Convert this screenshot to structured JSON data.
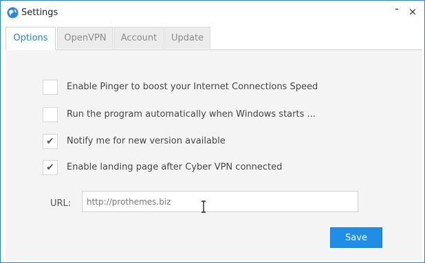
{
  "window": {
    "title": "Settings"
  },
  "controls": {
    "minimize": "-",
    "close": "×"
  },
  "tabs": [
    {
      "label": "Options",
      "active": true
    },
    {
      "label": "OpenVPN",
      "active": false
    },
    {
      "label": "Account",
      "active": false
    },
    {
      "label": "Update",
      "active": false
    }
  ],
  "options": [
    {
      "label": "Enable Pinger to boost your Internet Connections Speed",
      "checked": false
    },
    {
      "label": "Run the program automatically when Windows starts ...",
      "checked": false
    },
    {
      "label": "Notify me for new version available",
      "checked": true
    },
    {
      "label": "Enable landing page after Cyber VPN connected",
      "checked": true
    }
  ],
  "url": {
    "label": "URL:",
    "value": "http://prothemes.biz"
  },
  "save_label": "Save",
  "colors": {
    "accent": "#1e8ee6",
    "border": "#2a7fcf",
    "panel_bg": "#f4f4f4"
  },
  "icons": {
    "app": "globe-icon",
    "checked": "check-icon"
  }
}
